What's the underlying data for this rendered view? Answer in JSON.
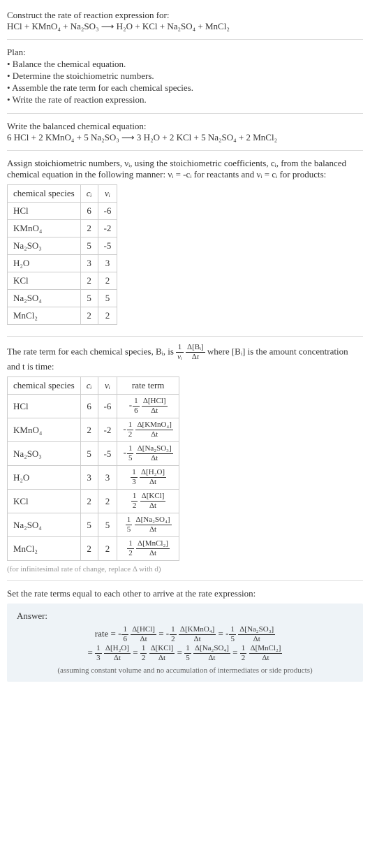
{
  "title": "Construct the rate of reaction expression for:",
  "equation_unbalanced": "HCl + KMnO₄ + Na₂SO₃  ⟶  H₂O + KCl + Na₂SO₄ + MnCl₂",
  "plan_title": "Plan:",
  "plan_items": [
    "• Balance the chemical equation.",
    "• Determine the stoichiometric numbers.",
    "• Assemble the rate term for each chemical species.",
    "• Write the rate of reaction expression."
  ],
  "balanced_title": "Write the balanced chemical equation:",
  "equation_balanced": "6 HCl + 2 KMnO₄ + 5 Na₂SO₃  ⟶  3 H₂O + 2 KCl + 5 Na₂SO₄ + 2 MnCl₂",
  "stoich_text1": "Assign stoichiometric numbers, νᵢ, using the stoichiometric coefficients, cᵢ, from the balanced chemical equation in the following manner: νᵢ = -cᵢ for reactants and νᵢ = cᵢ for products:",
  "table1": {
    "headers": [
      "chemical species",
      "cᵢ",
      "νᵢ"
    ],
    "rows": [
      [
        "HCl",
        "6",
        "-6"
      ],
      [
        "KMnO₄",
        "2",
        "-2"
      ],
      [
        "Na₂SO₃",
        "5",
        "-5"
      ],
      [
        "H₂O",
        "3",
        "3"
      ],
      [
        "KCl",
        "2",
        "2"
      ],
      [
        "Na₂SO₄",
        "5",
        "5"
      ],
      [
        "MnCl₂",
        "2",
        "2"
      ]
    ]
  },
  "rate_term_text_pre": "The rate term for each chemical species, Bᵢ, is ",
  "rate_term_text_post": " where [Bᵢ] is the amount concentration and t is time:",
  "table2": {
    "headers": [
      "chemical species",
      "cᵢ",
      "νᵢ",
      "rate term"
    ],
    "rows": [
      {
        "sp": "HCl",
        "c": "6",
        "v": "-6",
        "sign": "-",
        "coef_num": "1",
        "coef_den": "6",
        "dnum": "Δ[HCl]",
        "dden": "Δt"
      },
      {
        "sp": "KMnO₄",
        "c": "2",
        "v": "-2",
        "sign": "-",
        "coef_num": "1",
        "coef_den": "2",
        "dnum": "Δ[KMnO₄]",
        "dden": "Δt"
      },
      {
        "sp": "Na₂SO₃",
        "c": "5",
        "v": "-5",
        "sign": "-",
        "coef_num": "1",
        "coef_den": "5",
        "dnum": "Δ[Na₂SO₃]",
        "dden": "Δt"
      },
      {
        "sp": "H₂O",
        "c": "3",
        "v": "3",
        "sign": "",
        "coef_num": "1",
        "coef_den": "3",
        "dnum": "Δ[H₂O]",
        "dden": "Δt"
      },
      {
        "sp": "KCl",
        "c": "2",
        "v": "2",
        "sign": "",
        "coef_num": "1",
        "coef_den": "2",
        "dnum": "Δ[KCl]",
        "dden": "Δt"
      },
      {
        "sp": "Na₂SO₄",
        "c": "5",
        "v": "5",
        "sign": "",
        "coef_num": "1",
        "coef_den": "5",
        "dnum": "Δ[Na₂SO₄]",
        "dden": "Δt"
      },
      {
        "sp": "MnCl₂",
        "c": "2",
        "v": "2",
        "sign": "",
        "coef_num": "1",
        "coef_den": "2",
        "dnum": "Δ[MnCl₂]",
        "dden": "Δt"
      }
    ]
  },
  "caption": "(for infinitesimal rate of change, replace Δ with d)",
  "set_equal_text": "Set the rate terms equal to each other to arrive at the rate expression:",
  "answer_label": "Answer:",
  "rate_line1": {
    "lead": "rate = ",
    "terms": [
      {
        "sign": "-",
        "n": "1",
        "d": "6",
        "dn": "Δ[HCl]",
        "dd": "Δt"
      },
      {
        "sign": "-",
        "n": "1",
        "d": "2",
        "dn": "Δ[KMnO₄]",
        "dd": "Δt"
      },
      {
        "sign": "-",
        "n": "1",
        "d": "5",
        "dn": "Δ[Na₂SO₃]",
        "dd": "Δt"
      }
    ]
  },
  "rate_line2": {
    "lead": "= ",
    "terms": [
      {
        "sign": "",
        "n": "1",
        "d": "3",
        "dn": "Δ[H₂O]",
        "dd": "Δt"
      },
      {
        "sign": "",
        "n": "1",
        "d": "2",
        "dn": "Δ[KCl]",
        "dd": "Δt"
      },
      {
        "sign": "",
        "n": "1",
        "d": "5",
        "dn": "Δ[Na₂SO₄]",
        "dd": "Δt"
      },
      {
        "sign": "",
        "n": "1",
        "d": "2",
        "dn": "Δ[MnCl₂]",
        "dd": "Δt"
      }
    ]
  },
  "answer_note": "(assuming constant volume and no accumulation of intermediates or side products)",
  "chart_data": {
    "type": "table",
    "title": "Stoichiometric numbers and rate terms",
    "species": [
      "HCl",
      "KMnO4",
      "Na2SO3",
      "H2O",
      "KCl",
      "Na2SO4",
      "MnCl2"
    ],
    "c_i": [
      6,
      2,
      5,
      3,
      2,
      5,
      2
    ],
    "nu_i": [
      -6,
      -2,
      -5,
      3,
      2,
      5,
      2
    ],
    "rate_coefficients": [
      "-1/6",
      "-1/2",
      "-1/5",
      "1/3",
      "1/2",
      "1/5",
      "1/2"
    ]
  }
}
